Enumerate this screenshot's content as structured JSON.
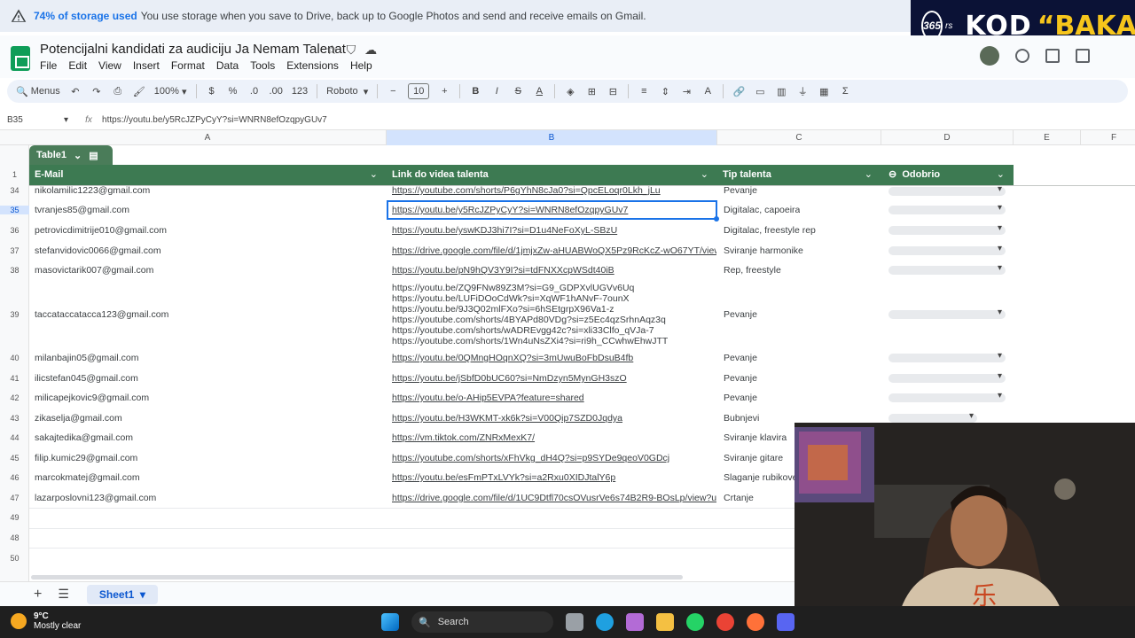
{
  "banner": {
    "bold": "74% of storage used",
    "text": "You use storage when you save to Drive, back up to Google Photos and send and receive emails on Gmail."
  },
  "overlay": {
    "badge": "365",
    "suffix": "rs",
    "kod": "KOD",
    "baka": "“BAKA”"
  },
  "doc": {
    "title": "Potencijalni kandidati za audiciju Ja Nemam Talenat"
  },
  "menu": [
    "File",
    "Edit",
    "View",
    "Insert",
    "Format",
    "Data",
    "Tools",
    "Extensions",
    "Help"
  ],
  "toolbar": {
    "search": "Menus",
    "zoom": "100%",
    "currency": "$",
    "percent": "%",
    "dec_dec": ".0",
    "dec_inc": ".00",
    "format123": "123",
    "font": "Roboto",
    "font_size": "10"
  },
  "formula": {
    "cell_ref": "B35",
    "value": "https://youtu.be/y5RcJZPyCyY?si=WNRN8efOzqpyGUv7"
  },
  "columns": [
    "A",
    "B",
    "C",
    "D",
    "E",
    "F"
  ],
  "table": {
    "name": "Table1",
    "headers": [
      "E-Mail",
      "Link do videa talenta",
      "Tip talenta",
      "Odobrio"
    ]
  },
  "rows": [
    {
      "num": "34",
      "email": "nikolamilic1223@gmail.com",
      "link": "https://youtube.com/shorts/P6gYhN8cJa0?si=QpcELoqr0Lkh_jLu",
      "tip": "Pevanje"
    },
    {
      "num": "35",
      "email": "tvranjes85@gmail.com",
      "link": "https://youtu.be/y5RcJZPyCyY?si=WNRN8efOzqpyGUv7",
      "tip": "Digitalac, capoeira"
    },
    {
      "num": "36",
      "email": "petrovicdimitrije010@gmail.com",
      "link": "https://youtu.be/yswKDJ3hi7I?si=D1u4NeFoXyL-SBzU",
      "tip": "Digitalac, freestyle rep"
    },
    {
      "num": "37",
      "email": "stefanvidovic0066@gmail.com",
      "link": "https://drive.google.com/file/d/1jmjxZw-aHUABWoQX5Pz9RcKcZ-wO67YT/view?u",
      "tip": "Sviranje harmonike"
    },
    {
      "num": "38",
      "email": "masovictarik007@gmail.com",
      "link": "https://youtu.be/pN9hQV3Y9I?si=tdFNXXcpWSdt40iB",
      "tip": "Rep, freestyle"
    },
    {
      "num": "39",
      "email": "taccataccatacca123@gmail.com",
      "links": [
        "https://youtu.be/ZQ9FNw89Z3M?si=G9_GDPXvlUGVv6Uq",
        "https://youtu.be/LUFiDOoCdWk?si=XqWF1hANvF-7ounX",
        "https://youtu.be/9J3Q02mlFXo?si=6hSEtgrpX96Va1-z",
        "https://youtube.com/shorts/4BYAPd80VDg?si=z5Ec4qzSrhnAqz3q",
        "https://youtube.com/shorts/wADREvgg42c?si=xli33Clfo_qVJa-7",
        "https://youtube.com/shorts/1Wn4uNsZXi4?si=ri9h_CCwhwEhwJTT"
      ],
      "tip": "Pevanje"
    },
    {
      "num": "40",
      "email": "milanbajin05@gmail.com",
      "link": "https://youtu.be/0QMngHOqnXQ?si=3mUwuBoFbDsuB4fb",
      "tip": "Pevanje"
    },
    {
      "num": "41",
      "email": "ilicstefan045@gmail.com",
      "link": "https://youtu.be/jSbfD0bUC60?si=NmDzyn5MynGH3szO",
      "tip": "Pevanje"
    },
    {
      "num": "42",
      "email": "milicapejkovic9@gmail.com",
      "link": "https://youtu.be/o-AHip5EVPA?feature=shared",
      "tip": "Pevanje"
    },
    {
      "num": "43",
      "email": "zikaselja@gmail.com",
      "link": "https://youtu.be/H3WKMT-xk6k?si=V00Qip7SZD0Jqdya",
      "tip": "Bubnjevi"
    },
    {
      "num": "44",
      "email": "sakajtedika@gmail.com",
      "link": "https://vm.tiktok.com/ZNRxMexK7/",
      "tip": "Sviranje klavira"
    },
    {
      "num": "45",
      "email": "filip.kumic29@gmail.com",
      "link": "https://youtube.com/shorts/xFhVkg_dH4Q?si=p9SYDe9qeoV0GDcj",
      "tip": "Sviranje gitare"
    },
    {
      "num": "46",
      "email": "marcokmatej@gmail.com",
      "link": "https://youtu.be/esFmPTxLVYk?si=a2Rxu0XIDJtalY6p",
      "tip": "Slaganje rubikove"
    },
    {
      "num": "47",
      "email": "lazarposlovni123@gmail.com",
      "link": "https://drive.google.com/file/d/1UC9Dtfl70csOVusrVe6s74B2R9-BOsLp/view?usp",
      "tip": "Crtanje"
    },
    {
      "num": "48"
    },
    {
      "num": "49"
    },
    {
      "num": "50"
    }
  ],
  "sheet": {
    "tab": "Sheet1"
  },
  "taskbar": {
    "temp": "9°C",
    "weather": "Mostly clear",
    "search": "Search"
  }
}
